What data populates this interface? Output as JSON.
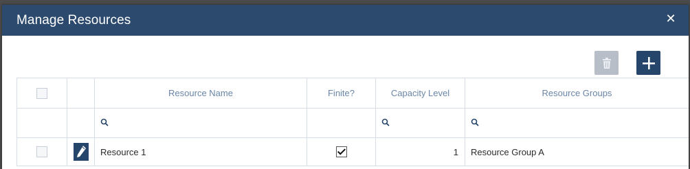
{
  "dialog": {
    "title": "Manage Resources",
    "close_icon": "close-icon"
  },
  "toolbar": {
    "delete_icon": "trash-icon",
    "add_icon": "plus-icon",
    "delete_enabled": false
  },
  "grid": {
    "columns": [
      "",
      "",
      "Resource Name",
      "Finite?",
      "Capacity Level",
      "Resource Groups"
    ],
    "rows": [
      {
        "selected": false,
        "edit_icon": "pencil-icon",
        "resource_name": "Resource 1",
        "finite": true,
        "capacity_level": "1",
        "resource_groups": "Resource Group A"
      }
    ]
  },
  "colors": {
    "titlebar": "#2c4a6e",
    "accent": "#26456b",
    "header_text": "#6a86a8",
    "disabled_button": "#b8bec7"
  }
}
